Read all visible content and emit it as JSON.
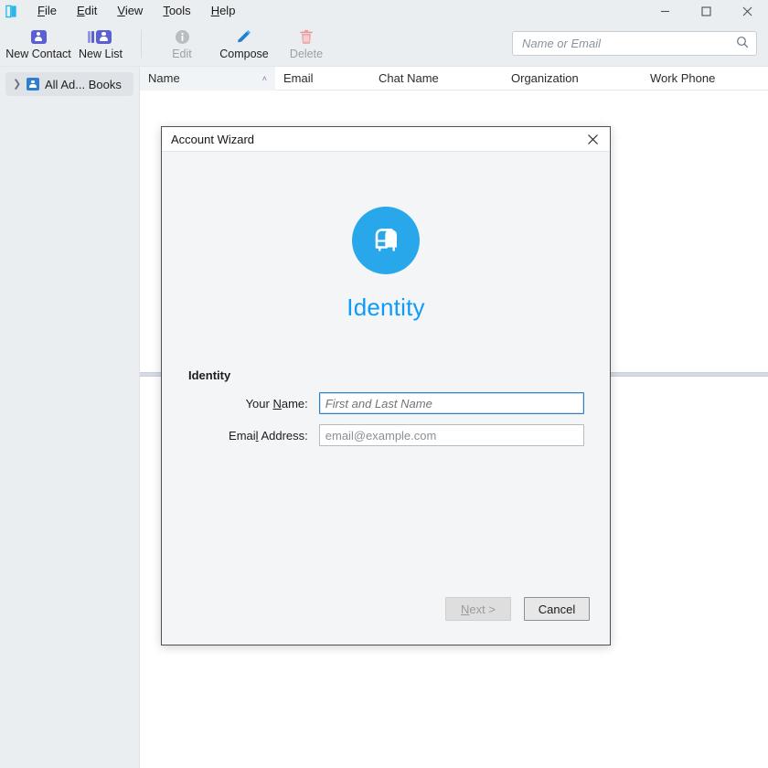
{
  "window": {
    "app_icon": "address-book-icon",
    "controls": {
      "minimize": "minimize-icon",
      "maximize": "maximize-icon",
      "close": "close-icon"
    }
  },
  "menu": {
    "items": [
      {
        "label": "File",
        "mnemonic": "F",
        "rest": "ile"
      },
      {
        "label": "Edit",
        "mnemonic": "E",
        "rest": "dit"
      },
      {
        "label": "View",
        "mnemonic": "V",
        "rest": "iew"
      },
      {
        "label": "Tools",
        "mnemonic": "T",
        "rest": "ools"
      },
      {
        "label": "Help",
        "mnemonic": "H",
        "rest": "elp"
      }
    ]
  },
  "toolbar": {
    "buttons": [
      {
        "label": "New Contact",
        "icon": "new-contact-icon",
        "disabled": false
      },
      {
        "label": "New List",
        "icon": "new-list-icon",
        "disabled": false
      },
      {
        "label": "Edit",
        "icon": "info-icon",
        "disabled": true
      },
      {
        "label": "Compose",
        "icon": "pencil-icon",
        "disabled": false
      },
      {
        "label": "Delete",
        "icon": "trash-icon",
        "disabled": true
      }
    ]
  },
  "search": {
    "placeholder": "Name or Email",
    "value": "",
    "icon": "search-icon"
  },
  "sidebar": {
    "items": [
      {
        "label": "All Ad... Books",
        "icon": "address-book-icon",
        "chevron": "chevron-right-icon",
        "selected": true
      }
    ]
  },
  "contacts_table": {
    "columns": [
      {
        "label": "Name",
        "sorted": true,
        "sort_caret": "˄"
      },
      {
        "label": "Email",
        "sorted": false
      },
      {
        "label": "Chat Name",
        "sorted": false
      },
      {
        "label": "Organization",
        "sorted": false
      },
      {
        "label": "Work Phone",
        "sorted": false
      }
    ],
    "rows": []
  },
  "dialog": {
    "title": "Account Wizard",
    "close_icon": "close-icon",
    "logo_icon": "mailbox-icon",
    "heading": "Identity",
    "group_label": "Identity",
    "fields": [
      {
        "label_pre": "Your ",
        "label_mnemonic": "N",
        "label_post": "ame:",
        "placeholder": "First and Last Name",
        "value": "",
        "focused": true,
        "italic_placeholder": true
      },
      {
        "label_pre": "Emai",
        "label_mnemonic": "l",
        "label_post": " Address:",
        "placeholder": "email@example.com",
        "value": "",
        "focused": false,
        "italic_placeholder": false
      }
    ],
    "buttons": {
      "next": {
        "label_pre": "",
        "mnemonic": "N",
        "label_post": "ext >",
        "disabled": true
      },
      "cancel": {
        "label": "Cancel",
        "disabled": false
      }
    }
  },
  "colors": {
    "accent_blue": "#0d9bfa",
    "logo_blue": "#28a8ea",
    "toolbar_bg": "#eaeef1",
    "sidebar_bg": "#eaeef1",
    "dialog_bg": "#f4f5f7",
    "contact_icon_purple": "#5a5fd4",
    "delete_red": "#e8a0a0"
  }
}
